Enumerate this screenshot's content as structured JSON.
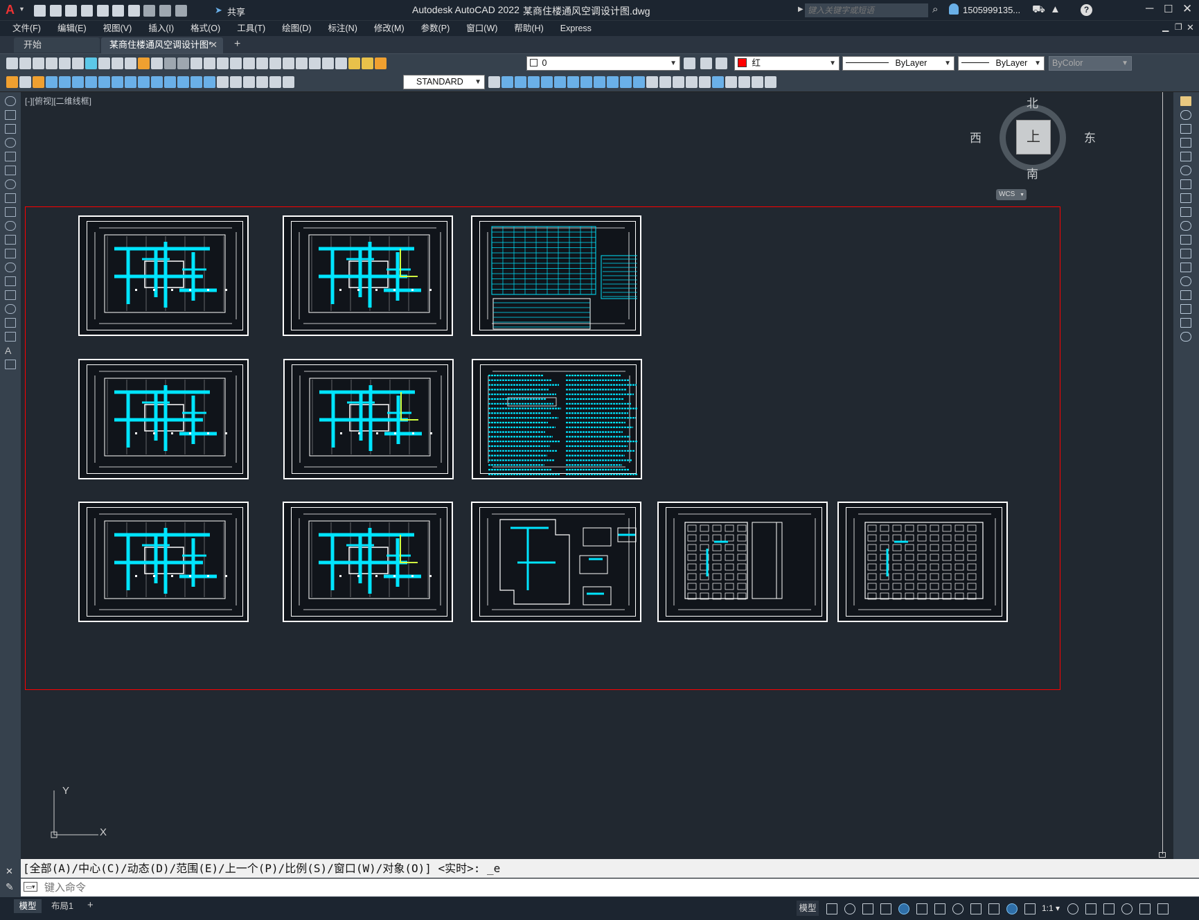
{
  "title": {
    "app": "Autodesk AutoCAD 2022",
    "file": "某商住楼通风空调设计图.dwg",
    "search_placeholder": "键入关键字或短语",
    "user": "1505999135...",
    "share": "共享"
  },
  "menu": [
    "文件(F)",
    "编辑(E)",
    "视图(V)",
    "插入(I)",
    "格式(O)",
    "工具(T)",
    "绘图(D)",
    "标注(N)",
    "修改(M)",
    "参数(P)",
    "窗口(W)",
    "帮助(H)",
    "Express"
  ],
  "tabs": {
    "start": "开始",
    "active": "某商住楼通风空调设计图*"
  },
  "toolbar": {
    "layer_value": "0",
    "color_value": "红",
    "color_hex": "#ff0000",
    "linetype_value": "ByLayer",
    "lineweight_value": "ByLayer",
    "plotstyle_value": "ByColor",
    "textstyle_value": "STANDARD"
  },
  "viewport": {
    "label": "[-][俯视][二维线框]"
  },
  "viewcube": {
    "north": "北",
    "south": "南",
    "east": "东",
    "west": "西",
    "face": "上",
    "wcs": "WCS"
  },
  "ucs": {
    "x": "X",
    "y": "Y"
  },
  "command": {
    "history": "[全部(A)/中心(C)/动态(D)/范围(E)/上一个(P)/比例(S)/窗口(W)/对象(O)] <实时>: _e",
    "placeholder": "键入命令"
  },
  "layout_tabs": [
    "模型",
    "布局1"
  ],
  "status": {
    "model": "模型",
    "scale": "1:1"
  },
  "colors": {
    "drawing_lines": "#ffffff",
    "ducts": "#00e5ff",
    "frame": "#ff0000",
    "background": "#212830"
  }
}
